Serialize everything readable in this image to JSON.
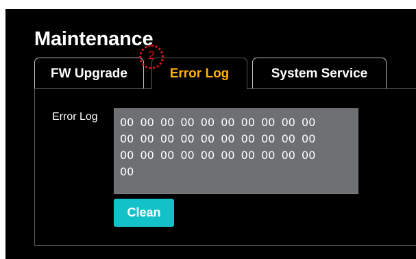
{
  "page": {
    "title": "Maintenance"
  },
  "tabs": [
    {
      "label": "FW Upgrade",
      "active": false
    },
    {
      "label": "Error Log",
      "active": true
    },
    {
      "label": "System Service",
      "active": false
    }
  ],
  "error_log": {
    "label": "Error Log",
    "value": "00 00 00 00 00 00 00 00 00 00\n00 00 00 00 00 00 00 00 00 00\n00 00 00 00 00 00 00 00 00 00\n00"
  },
  "clean_button": {
    "label": "Clean"
  },
  "annotation": {
    "marker_number": "2"
  },
  "colors": {
    "background": "#000000",
    "active_tab_text": "#ffb000",
    "log_box": "#6d6f72",
    "clean_button": "#13c2c8",
    "annotation": "#e0151b"
  }
}
